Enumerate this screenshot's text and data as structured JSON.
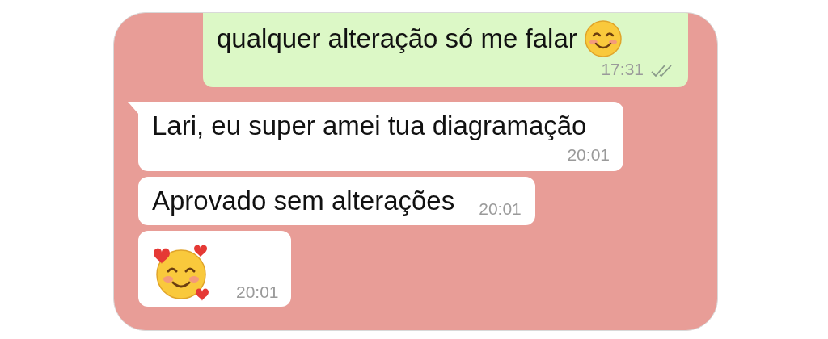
{
  "messages": [
    {
      "outgoing": true,
      "kind": "text_with_emoji",
      "text": "qualquer alteração só me falar",
      "time": "17:31",
      "delivered": true,
      "tail": false
    },
    {
      "outgoing": false,
      "kind": "text",
      "text": "Lari, eu super amei tua diagramação",
      "time": "20:01",
      "tail": true
    },
    {
      "outgoing": false,
      "kind": "text",
      "text": "Aprovado sem alterações",
      "time": "20:01",
      "tail": false
    },
    {
      "outgoing": false,
      "kind": "emoji",
      "time": "20:01",
      "tail": false
    }
  ]
}
